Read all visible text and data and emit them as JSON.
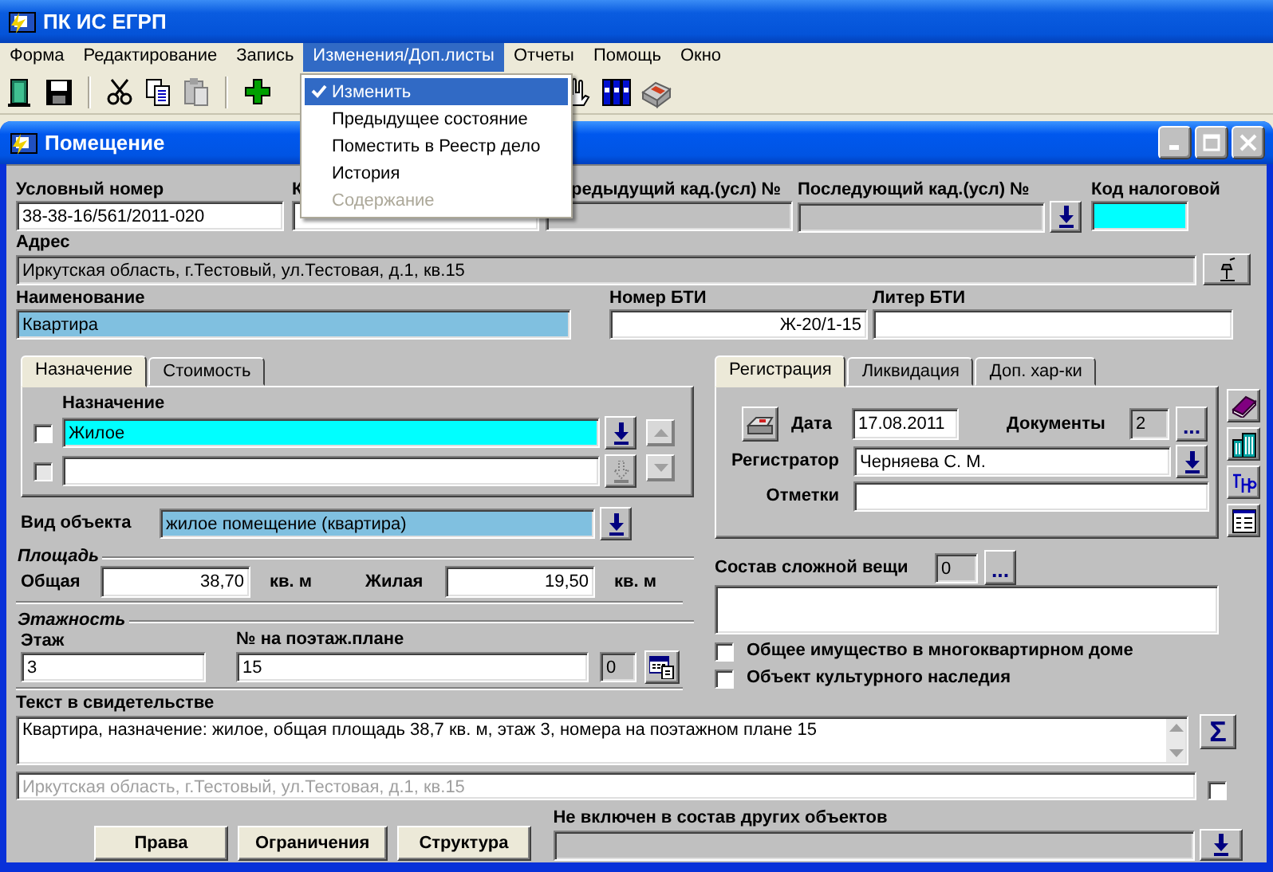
{
  "window": {
    "title": "ПК ИС ЕГРП"
  },
  "menu": [
    {
      "label": "Форма",
      "selected": false
    },
    {
      "label": "Редактирование",
      "selected": false
    },
    {
      "label": "Запись",
      "selected": false
    },
    {
      "label": "Изменения/Доп.листы",
      "selected": true
    },
    {
      "label": "Отчеты",
      "selected": false
    },
    {
      "label": "Помощь",
      "selected": false
    },
    {
      "label": "Окно",
      "selected": false
    }
  ],
  "dropdown": [
    {
      "label": "Изменить",
      "checked": true,
      "selected": true,
      "disabled": false
    },
    {
      "label": "Предыдущее состояние",
      "checked": false,
      "selected": false,
      "disabled": false
    },
    {
      "label": "Поместить в Реестр дело",
      "checked": false,
      "selected": false,
      "disabled": false
    },
    {
      "label": "История",
      "checked": false,
      "selected": false,
      "disabled": false
    },
    {
      "label": "Содержание",
      "checked": false,
      "selected": false,
      "disabled": true
    }
  ],
  "child_window": {
    "title": "Помещение"
  },
  "header_fields": [
    {
      "label": "Условный номер",
      "value": "38-38-16/561/2011-020",
      "kind": "editable"
    },
    {
      "label": "К",
      "kind": "editable"
    },
    {
      "label": "редыдущий кад.(усл) №",
      "kind": "readonly"
    },
    {
      "label": "Последующий кад.(усл) №",
      "kind": "readonly"
    },
    {
      "label": "Код налоговой",
      "kind": "required"
    }
  ],
  "address": {
    "label": "Адрес",
    "value": "Иркутская область, г.Тестовый, ул.Тестовая, д.1, кв.15",
    "kind": "readonly"
  },
  "name": {
    "label": "Наименование",
    "value": "Квартира",
    "kind": "reference"
  },
  "bti_number": {
    "label": "Номер БТИ",
    "value": "Ж-20/1-15",
    "kind": "editable"
  },
  "bti_letter": {
    "label": "Литер БТИ",
    "kind": "editable"
  },
  "purpose_panel": {
    "tabs": [
      {
        "label": "Назначение",
        "selected": true
      },
      {
        "label": "Стоимость",
        "selected": false
      }
    ],
    "column": "Назначение",
    "rows": [
      {
        "value": "Жилое",
        "checked": false,
        "selected": true,
        "disabled": false
      },
      {
        "checked": false,
        "selected": false,
        "disabled": true
      }
    ]
  },
  "object_type": {
    "label": "Вид объекта",
    "value": "жилое помещение (квартира)",
    "kind": "reference"
  },
  "area": {
    "title": "Площадь",
    "total": {
      "label": "Общая",
      "value": "38,70",
      "unit": "кв. м"
    },
    "living": {
      "label": "Жилая",
      "value": "19,50",
      "unit": "кв. м"
    }
  },
  "floors": {
    "title": "Этажность",
    "floor": {
      "label": "Этаж",
      "value": "3"
    },
    "plan_number": {
      "label": "№ на поэтаж.плане",
      "value": "15"
    },
    "count": "0"
  },
  "registration_panel": {
    "tabs": [
      {
        "label": "Регистрация",
        "selected": true
      },
      {
        "label": "Ликвидация",
        "selected": false
      },
      {
        "label": "Доп. хар-ки",
        "selected": false
      }
    ],
    "date": {
      "label": "Дата",
      "value": "17.08.2011"
    },
    "documents": {
      "label": "Документы",
      "value": "2",
      "button": "..."
    },
    "registrar": {
      "label": "Регистратор",
      "value": "Черняева С. М."
    },
    "notes": {
      "label": "Отметки"
    }
  },
  "complex_thing": {
    "label": "Состав сложной вещи",
    "count": "0",
    "button": "..."
  },
  "flags": [
    {
      "label": "Общее имущество в многоквартирном доме",
      "checked": false
    },
    {
      "label": "Объект культурного наследия",
      "checked": false
    }
  ],
  "certificate": {
    "label": "Текст в свидетельстве",
    "value": "Квартира, назначение: жилое, общая площадь 38,7 кв. м, этаж 3, номера на поэтажном плане 15",
    "sum_button": "Σ",
    "address": "Иркутская область, г.Тестовый, ул.Тестовая, д.1, кв.15",
    "address_checked": false
  },
  "buttons": [
    "Права",
    "Ограничения",
    "Структура"
  ],
  "inclusion": {
    "label": "Не включен в состав других объектов"
  }
}
